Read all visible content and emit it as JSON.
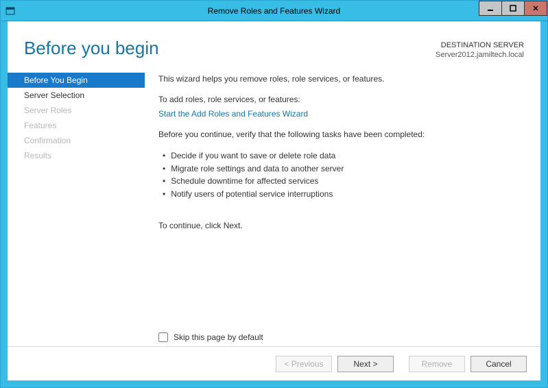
{
  "window": {
    "title": "Remove Roles and Features Wizard"
  },
  "header": {
    "page_title": "Before you begin",
    "dest_label": "DESTINATION SERVER",
    "dest_value": "Server2012.jamiltech.local"
  },
  "nav": {
    "items": [
      {
        "label": "Before You Begin",
        "state": "active"
      },
      {
        "label": "Server Selection",
        "state": "enabled"
      },
      {
        "label": "Server Roles",
        "state": "disabled"
      },
      {
        "label": "Features",
        "state": "disabled"
      },
      {
        "label": "Confirmation",
        "state": "disabled"
      },
      {
        "label": "Results",
        "state": "disabled"
      }
    ]
  },
  "content": {
    "intro": "This wizard helps you remove roles, role services, or features.",
    "add_hint": "To add roles, role services, or features:",
    "add_link": "Start the Add Roles and Features Wizard",
    "verify": "Before you continue, verify that the following tasks have been completed:",
    "bullets": [
      "Decide if you want to save or delete role data",
      "Migrate role settings and data to another server",
      "Schedule downtime for affected services",
      "Notify users of potential service interruptions"
    ],
    "continue": "To continue, click Next.",
    "skip_label": "Skip this page by default"
  },
  "buttons": {
    "previous": "< Previous",
    "next": "Next >",
    "remove": "Remove",
    "cancel": "Cancel"
  }
}
